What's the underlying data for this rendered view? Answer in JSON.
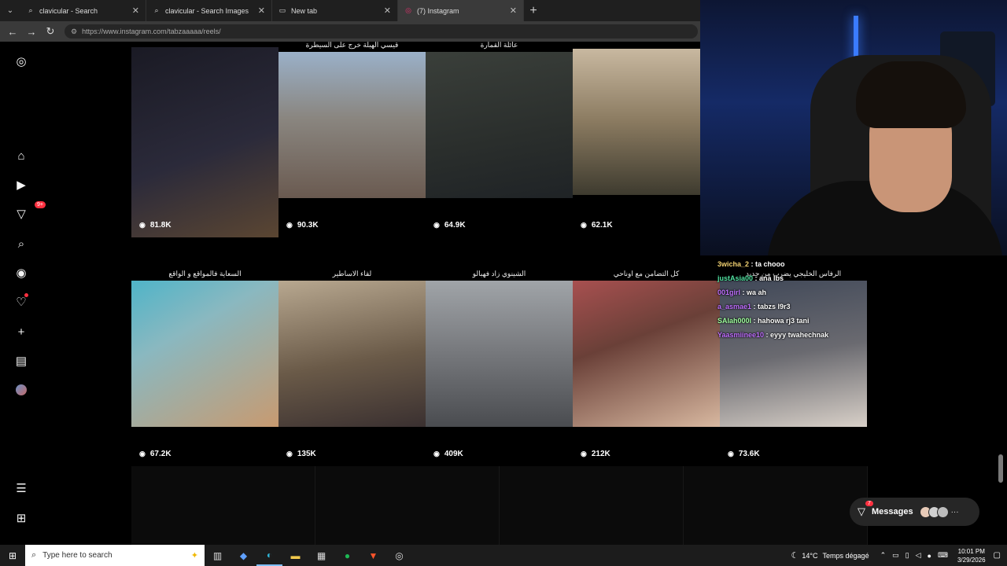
{
  "browser": {
    "tabs": [
      {
        "title": "clavicular - Search",
        "icon": "search-icon",
        "active": false
      },
      {
        "title": "clavicular - Search Images",
        "icon": "search-icon",
        "active": false
      },
      {
        "title": "New tab",
        "icon": "newtab-icon",
        "active": false
      },
      {
        "title": "(7) Instagram",
        "icon": "instagram-icon",
        "active": true
      }
    ],
    "url": "https://www.instagram.com/tabzaaaaa/reels/"
  },
  "sidebar": {
    "notifications_badge": "9+"
  },
  "reels": [
    {
      "title": "",
      "views": "81.8K",
      "colors": [
        "#1a1a24",
        "#5b4632"
      ]
    },
    {
      "title": "قيسي الهبلة خرج على السيطرة",
      "views": "90.3K",
      "colors": [
        "#9ab0c8",
        "#6a5a50"
      ]
    },
    {
      "title": "عائلة القمارة",
      "views": "64.9K",
      "colors": [
        "#3a3f3a",
        "#1f2326"
      ]
    },
    {
      "title": "",
      "views": "62.1K",
      "colors": [
        "#c8b8a0",
        "#3e3b2f"
      ]
    },
    {
      "title": "السعاية فالمواقع و الواقع",
      "views": "67.2K",
      "colors": [
        "#4fb4c8",
        "#c89a70"
      ]
    },
    {
      "title": "لقاء الاساطير",
      "views": "135K",
      "colors": [
        "#b8a890",
        "#3a3030"
      ]
    },
    {
      "title": "الشينوي زاد فهبالو",
      "views": "409K",
      "colors": [
        "#a0a4a8",
        "#4a4c50"
      ]
    },
    {
      "title": "كل التضامن مع اوناحي",
      "views": "212K",
      "colors": [
        "#a85050",
        "#d8b8a0"
      ]
    },
    {
      "title": "الرفاس الخليجي يضرب من جديد",
      "views": "73.6K",
      "colors": [
        "#404858",
        "#d8d0c8"
      ]
    }
  ],
  "chat": [
    {
      "user": "3wicha_2",
      "message": "ta chooo",
      "color": "#f0d070"
    },
    {
      "user": "justAsia00",
      "message": "ana lbs",
      "color": "#50e0a0"
    },
    {
      "user": "001girl",
      "message": "wa ah",
      "color": "#c070ff"
    },
    {
      "user": "a_asmae1",
      "message": "tabzs l9r3",
      "color": "#c070ff"
    },
    {
      "user": "SAlah000l",
      "message": "hahowa rj3 tani",
      "color": "#a0ffa0"
    },
    {
      "user": "Yaasmiinee10",
      "message": "eyyy twahechnak",
      "color": "#c070ff"
    }
  ],
  "messages": {
    "label": "Messages",
    "badge": "7"
  },
  "taskbar": {
    "search_placeholder": "Type here to search",
    "weather_temp": "14°C",
    "weather_text": "Temps dégagé",
    "time": "10:01 PM",
    "date": "3/29/2026"
  }
}
